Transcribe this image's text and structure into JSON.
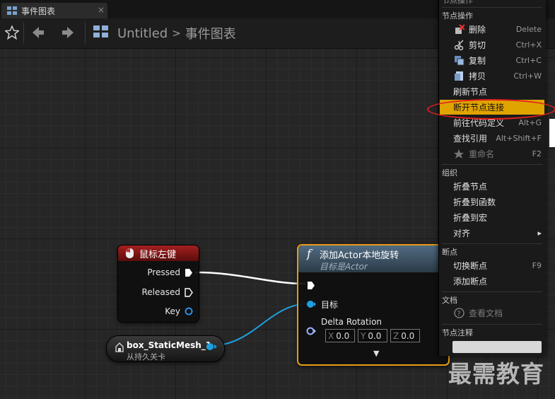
{
  "tab": {
    "title": "事件图表"
  },
  "breadcrumb": {
    "root": "Untitled",
    "separator": ">",
    "current": "事件图表"
  },
  "nodes": {
    "event": {
      "title": "鼠标左键",
      "pins": [
        "Pressed",
        "Released",
        "Key"
      ]
    },
    "variable": {
      "name": "box_StaticMesh_1",
      "source": "从持久关卡"
    },
    "function": {
      "icon_glyph": "f",
      "title": "添加Actor本地旋转",
      "subtitle": "目标是Actor",
      "target_label": "目标",
      "delta_label": "Delta Rotation",
      "delta": [
        {
          "axis": "X",
          "value": "0.0"
        },
        {
          "axis": "Y",
          "value": "0.0"
        },
        {
          "axis": "Z",
          "value": "0.0"
        }
      ],
      "expand_glyph": "▼"
    }
  },
  "context_menu": {
    "top_clipped": "节点操作",
    "sections": {
      "node_ops": "节点操作",
      "organize": "组织",
      "breakpoint": "断点",
      "docs": "文档",
      "comment": "节点注释"
    },
    "items": {
      "delete": {
        "label": "删除",
        "shortcut": "Delete"
      },
      "cut": {
        "label": "剪切",
        "shortcut": "Ctrl+X"
      },
      "copy": {
        "label": "复制",
        "shortcut": "Ctrl+C"
      },
      "duplicate": {
        "label": "拷贝",
        "shortcut": "Ctrl+W"
      },
      "refresh": {
        "label": "刷新节点"
      },
      "break_links": {
        "label": "断开节点连接"
      },
      "goto_def": {
        "label": "前往代码定义",
        "shortcut": "Alt+G"
      },
      "find_refs": {
        "label": "查找引用",
        "shortcut": "Alt+Shift+F"
      },
      "rename": {
        "label": "重命名",
        "shortcut": "F2"
      },
      "collapse": {
        "label": "折叠节点"
      },
      "collapse_func": {
        "label": "折叠到函数"
      },
      "collapse_macro": {
        "label": "折叠到宏"
      },
      "align": {
        "label": "对齐",
        "arrow": "▸"
      },
      "toggle_bp": {
        "label": "切换断点",
        "shortcut": "F9"
      },
      "add_bp": {
        "label": "添加断点"
      },
      "view_docs": {
        "label": "查看文档"
      }
    }
  },
  "watermark": "最需教育",
  "colors": {
    "highlight": "#e0a400",
    "exec_wire": "#ffffff",
    "object_wire": "#1ea0e0",
    "func_border": "#e89a16"
  }
}
